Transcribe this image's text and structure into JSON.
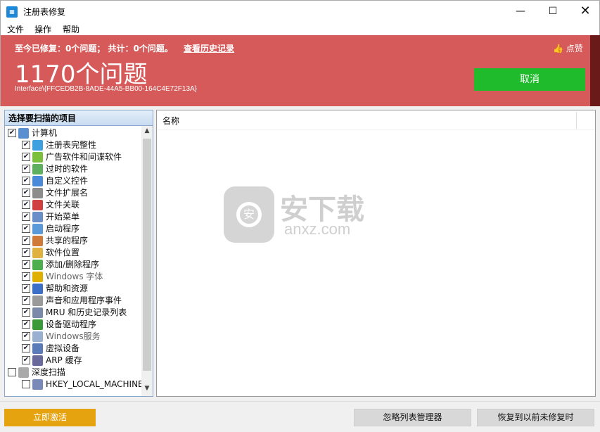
{
  "window": {
    "title": "注册表修复",
    "app_icon": "grid-icon"
  },
  "menu": [
    "文件",
    "操作",
    "帮助"
  ],
  "banner": {
    "stat_line": "至今已修复：0个问题； 共计：0个问题。",
    "history_link": "查看历史记录",
    "like_label": "点赞",
    "count": "1170个问题",
    "path": "Interface\\{FFCEDB2B-8ADE-44A5-BB00-164C4E72F13A}",
    "cancel_label": "取消",
    "accent": "#d65a5a",
    "cancel_color": "#1fbb2c"
  },
  "left_panel": {
    "header": "选择要扫描的项目",
    "items": [
      {
        "label": "计算机",
        "checked": true,
        "level": 0,
        "icon": "computer-icon",
        "icon_color": "#5a8fd0"
      },
      {
        "label": "注册表完整性",
        "checked": true,
        "level": 1,
        "icon": "registry-icon",
        "icon_color": "#3fa0e0"
      },
      {
        "label": "广告软件和间谍软件",
        "checked": true,
        "level": 1,
        "icon": "shield-icon",
        "icon_color": "#7cbf3c"
      },
      {
        "label": "过时的软件",
        "checked": true,
        "level": 1,
        "icon": "trash-icon",
        "icon_color": "#5eb05e"
      },
      {
        "label": "自定义控件",
        "checked": true,
        "level": 1,
        "icon": "blocks-icon",
        "icon_color": "#4a8ad8"
      },
      {
        "label": "文件扩展名",
        "checked": true,
        "level": 1,
        "icon": "file-icon",
        "icon_color": "#8c8c8c"
      },
      {
        "label": "文件关联",
        "checked": true,
        "level": 1,
        "icon": "font-file-icon",
        "icon_color": "#d04040"
      },
      {
        "label": "开始菜单",
        "checked": true,
        "level": 1,
        "icon": "menu-icon",
        "icon_color": "#6a8ec8"
      },
      {
        "label": "启动程序",
        "checked": true,
        "level": 1,
        "icon": "window-icon",
        "icon_color": "#5a9ad8"
      },
      {
        "label": "共享的程序",
        "checked": true,
        "level": 1,
        "icon": "share-icon",
        "icon_color": "#d07a3a"
      },
      {
        "label": "软件位置",
        "checked": true,
        "level": 1,
        "icon": "folder-icon",
        "icon_color": "#e0b040"
      },
      {
        "label": "添加/删除程序",
        "checked": true,
        "level": 1,
        "icon": "recycle-icon",
        "icon_color": "#4cae4c"
      },
      {
        "label": "Windows 字体",
        "checked": true,
        "level": 1,
        "icon": "font-icon",
        "icon_color": "#e0b000",
        "grey": true
      },
      {
        "label": "帮助和资源",
        "checked": true,
        "level": 1,
        "icon": "help-icon",
        "icon_color": "#3b6fc8"
      },
      {
        "label": "声音和应用程序事件",
        "checked": true,
        "level": 1,
        "icon": "sound-icon",
        "icon_color": "#9a9a9a"
      },
      {
        "label": "MRU 和历史记录列表",
        "checked": true,
        "level": 1,
        "icon": "history-icon",
        "icon_color": "#7a8aa8"
      },
      {
        "label": "设备驱动程序",
        "checked": true,
        "level": 1,
        "icon": "driver-icon",
        "icon_color": "#3a9a3a"
      },
      {
        "label": "Windows服务",
        "checked": true,
        "level": 1,
        "icon": "search-icon",
        "icon_color": "#9ab0d0",
        "grey": true
      },
      {
        "label": "虚拟设备",
        "checked": true,
        "level": 1,
        "icon": "device-icon",
        "icon_color": "#5a7ab8"
      },
      {
        "label": "ARP 缓存",
        "checked": true,
        "level": 1,
        "icon": "arp-icon",
        "icon_color": "#6a6a9a"
      },
      {
        "label": "深度扫描",
        "checked": false,
        "level": 0,
        "icon": "magnifier-icon",
        "icon_color": "#aaaaaa"
      },
      {
        "label": "HKEY_LOCAL_MACHINE",
        "checked": false,
        "level": 1,
        "icon": "hive-icon",
        "icon_color": "#7a8ab8"
      }
    ]
  },
  "right_panel": {
    "column_name": "名称",
    "watermark_main": "安下载",
    "watermark_sub": "anxz.com",
    "watermark_badge": "安"
  },
  "bottom": {
    "activate_label": "立即激活",
    "ignore_label": "忽略列表管理器",
    "restore_label": "恢复到以前未修复时",
    "activate_color": "#e5a30f"
  }
}
